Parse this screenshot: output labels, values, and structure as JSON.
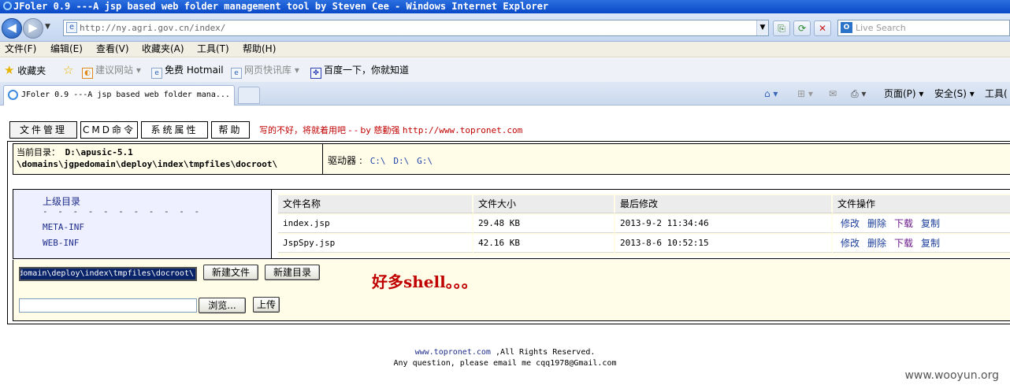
{
  "window": {
    "title": "JFoler 0.9 ---A jsp based web folder management tool by Steven Cee - Windows Internet Explorer"
  },
  "browser": {
    "url": "http://ny.agri.gov.cn/index/",
    "search_placeholder": "Live Search",
    "menu": [
      "文件(F)",
      "编辑(E)",
      "查看(V)",
      "收藏夹(A)",
      "工具(T)",
      "帮助(H)"
    ],
    "favorites_label": "收藏夹",
    "favorites": [
      "建议网站 ▾",
      "免费 Hotmail",
      "网页快讯库 ▾",
      "百度一下，你就知道"
    ],
    "tab_title": "JFoler 0.9 ---A jsp based web folder mana...",
    "commands": [
      "页面(P) ▾",
      "安全(S) ▾",
      "工具("
    ]
  },
  "page": {
    "nav_tabs": [
      "文件管理",
      "CMD命令",
      "系统属性",
      "帮助"
    ],
    "tagline_text": "写的不好，将就着用吧 - - by 慈勤强",
    "tagline_url": "http://www.topronet.com",
    "current_dir_label": "当前目录：",
    "current_dir_line1": "D:\\apusic-5.1",
    "current_dir_line2": "\\domains\\jgpedomain\\deploy\\index\\tmpfiles\\docroot\\",
    "drives_label": "驱动器 :",
    "drives": [
      "C:\\",
      "D:\\",
      "G:\\"
    ],
    "parent_dir": "上级目录",
    "dashes": "- - - - - - - - - - -",
    "directories": [
      "META-INF",
      "WEB-INF"
    ],
    "columns": [
      "文件名称",
      "文件大小",
      "最后修改",
      "文件操作"
    ],
    "files": [
      {
        "name": "index.jsp",
        "size": "29.48 KB",
        "modified": "2013-9-2 11:34:46"
      },
      {
        "name": "JspSpy.jsp",
        "size": "42.16 KB",
        "modified": "2013-8-6 10:52:15"
      }
    ],
    "file_ops": [
      "修改",
      "删除",
      "下载",
      "复制"
    ],
    "path_value": "\\domains\\jgpedomain\\deploy\\index\\tmpfiles\\docroot\\",
    "new_file_button": "新建文件",
    "new_dir_button": "新建目录",
    "browse_button": "浏览...",
    "upload_button": "上传",
    "note": "好多shell。。。",
    "footer_site": "www.topronet.com",
    "footer_rights": ",All Rights Reserved.",
    "footer_contact": "Any question, please email me cqq1978@Gmail.com"
  },
  "watermark": "www.wooyun.org"
}
